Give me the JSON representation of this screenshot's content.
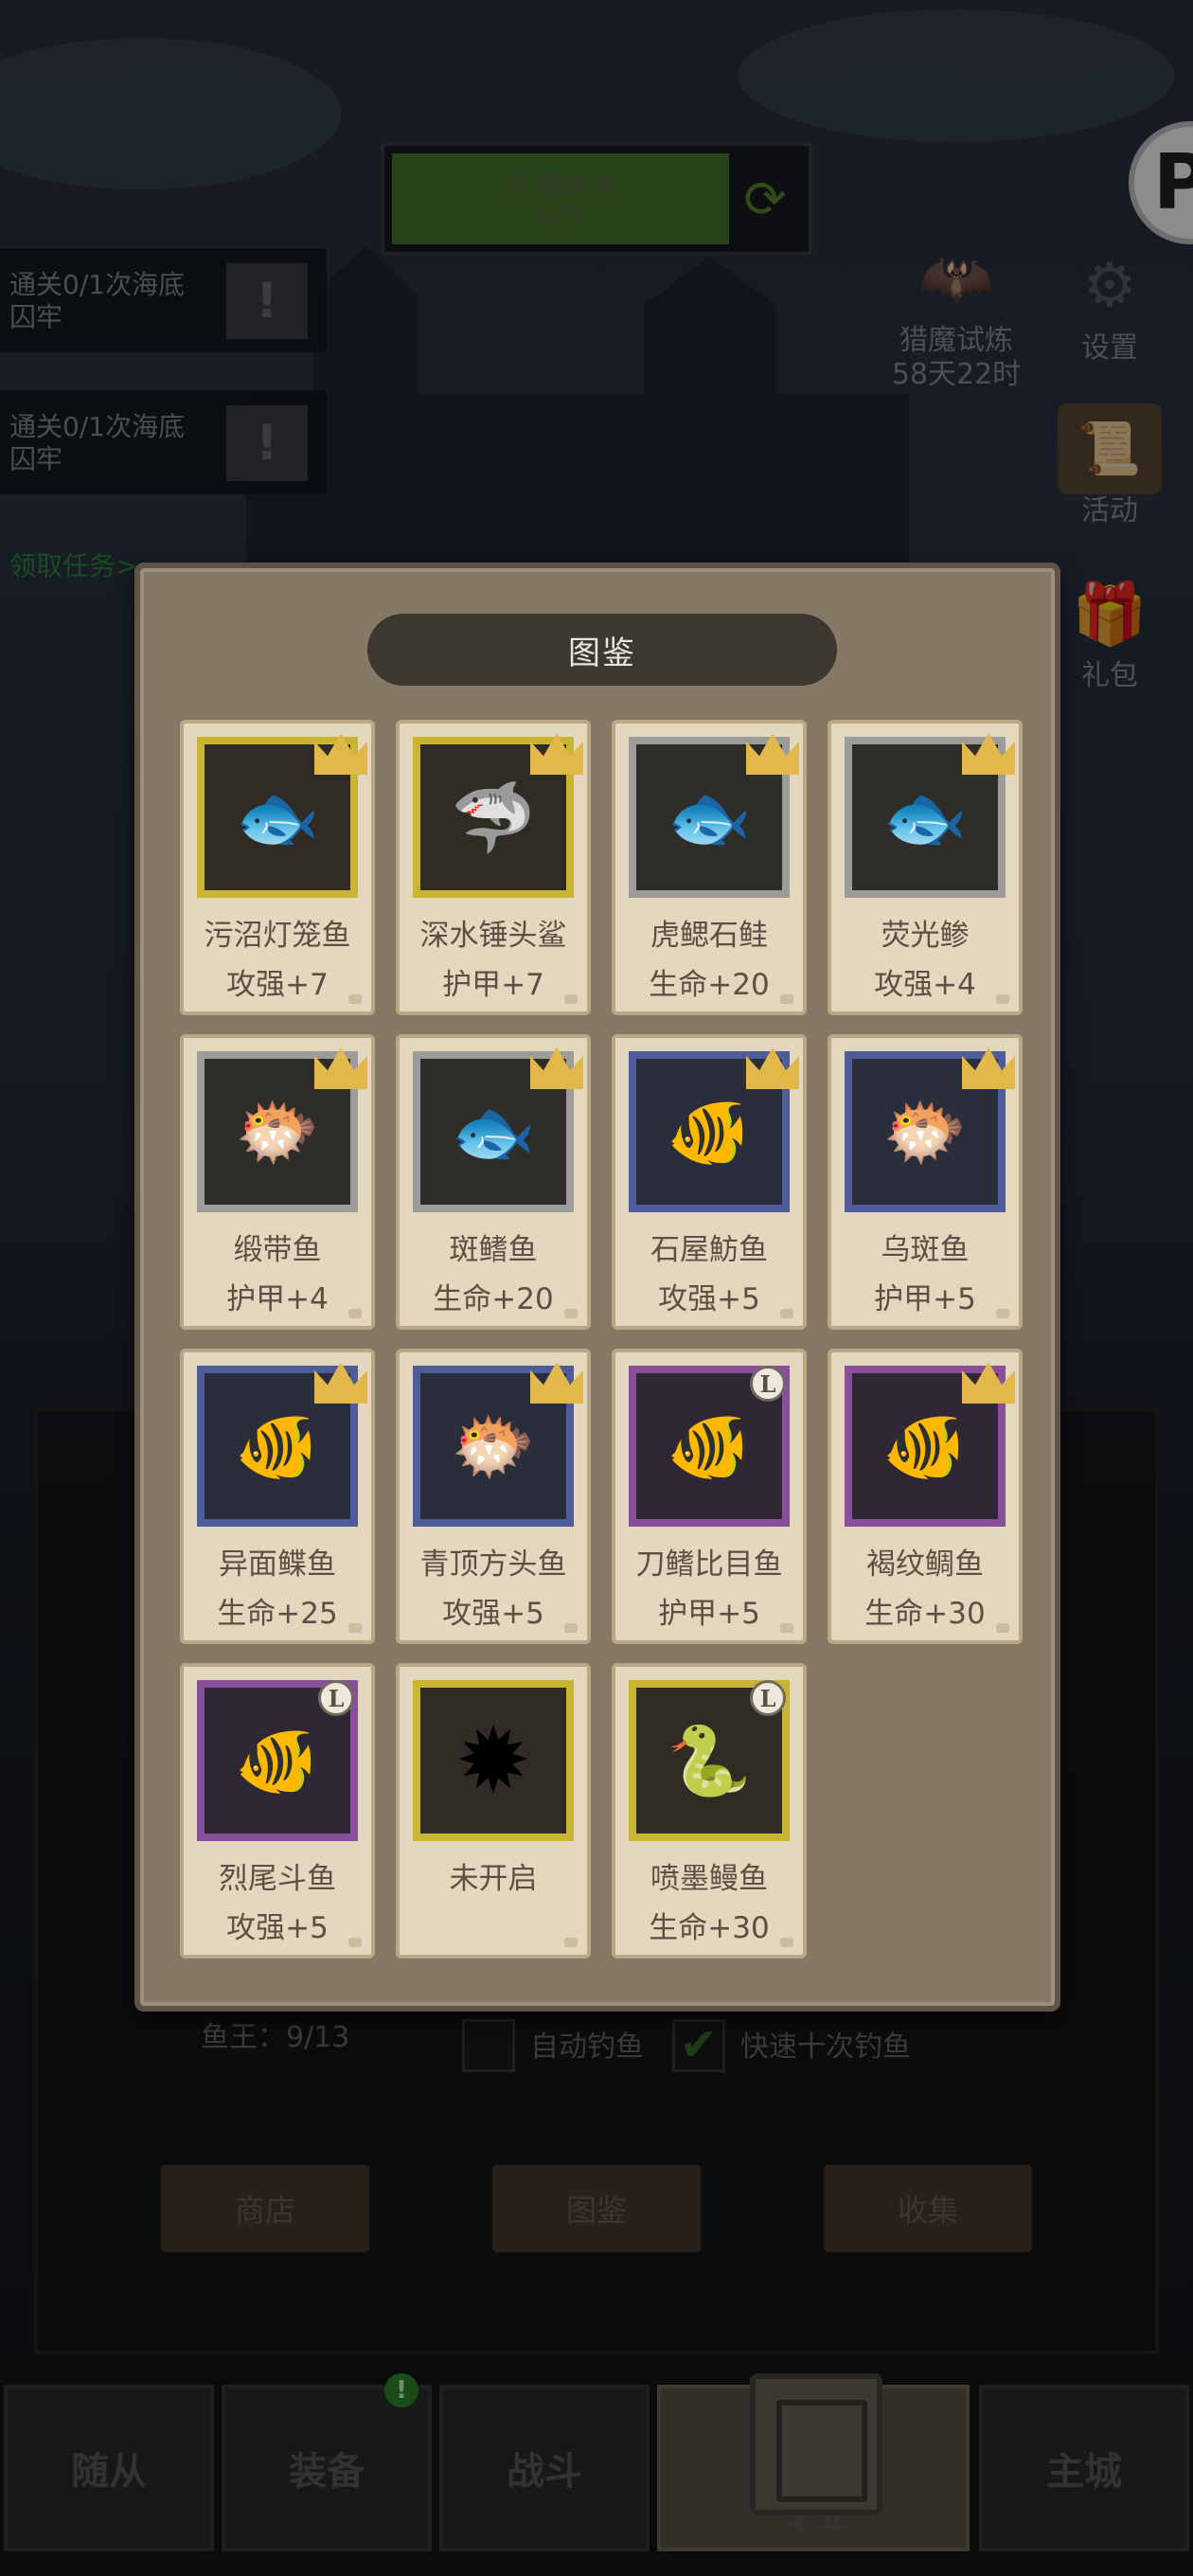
{
  "stage": {
    "name": "风暴峡湾",
    "progress": "4/5"
  },
  "quests": [
    {
      "text": "通关0/1次海底囚牢"
    },
    {
      "text": "通关0/1次海底囚牢"
    }
  ],
  "claim_task": "领取任务>",
  "right_icons": {
    "event_label": "猎魔试炼",
    "event_timer": "58天22时",
    "settings": "设置",
    "activity": "活动",
    "gift": "礼包"
  },
  "codex": {
    "title": "图鉴",
    "cards": [
      {
        "name": "污沼灯笼鱼",
        "bonus": "攻强+7",
        "rarity": "gold",
        "badge": "crown"
      },
      {
        "name": "深水锤头鲨",
        "bonus": "护甲+7",
        "rarity": "gold",
        "badge": "crown"
      },
      {
        "name": "虎鳃石鲑",
        "bonus": "生命+20",
        "rarity": "grey",
        "badge": "crown"
      },
      {
        "name": "荧光鲹",
        "bonus": "攻强+4",
        "rarity": "grey",
        "badge": "crown"
      },
      {
        "name": "缎带鱼",
        "bonus": "护甲+4",
        "rarity": "grey",
        "badge": "crown"
      },
      {
        "name": "斑鳍鱼",
        "bonus": "生命+20",
        "rarity": "grey",
        "badge": "crown"
      },
      {
        "name": "石屋魴鱼",
        "bonus": "攻强+5",
        "rarity": "blue",
        "badge": "crown"
      },
      {
        "name": "乌斑鱼",
        "bonus": "护甲+5",
        "rarity": "blue",
        "badge": "crown"
      },
      {
        "name": "异面鲽鱼",
        "bonus": "生命+25",
        "rarity": "blue",
        "badge": "crown"
      },
      {
        "name": "青顶方头鱼",
        "bonus": "攻强+5",
        "rarity": "blue",
        "badge": "crown"
      },
      {
        "name": "刀鳍比目鱼",
        "bonus": "护甲+5",
        "rarity": "purple",
        "badge": "L"
      },
      {
        "name": "褐纹鲷鱼",
        "bonus": "生命+30",
        "rarity": "purple",
        "badge": "crown"
      },
      {
        "name": "烈尾斗鱼",
        "bonus": "攻强+5",
        "rarity": "purple",
        "badge": "L"
      },
      {
        "name": "未开启",
        "bonus": "",
        "rarity": "gold",
        "badge": "none"
      },
      {
        "name": "喷墨鳗鱼",
        "bonus": "生命+30",
        "rarity": "gold",
        "badge": "L"
      }
    ]
  },
  "fishing": {
    "fish_king": "鱼王：9/13",
    "auto_fishing": "自动钓鱼",
    "fast_ten": "快速十次钓鱼"
  },
  "tabs_bottom_panel": {
    "shop": "商店",
    "codex": "图鉴",
    "collect": "收集"
  },
  "nav": {
    "followers": "随从",
    "equipment": "装备",
    "battle": "战斗",
    "profession": "专业",
    "main_city": "主城",
    "badge": "!"
  },
  "logo_letter": "P",
  "colors": {
    "gold": "#c9b531",
    "blue": "#4e5d9a",
    "purple": "#8a4f9a",
    "grey": "#9c9d9b"
  }
}
